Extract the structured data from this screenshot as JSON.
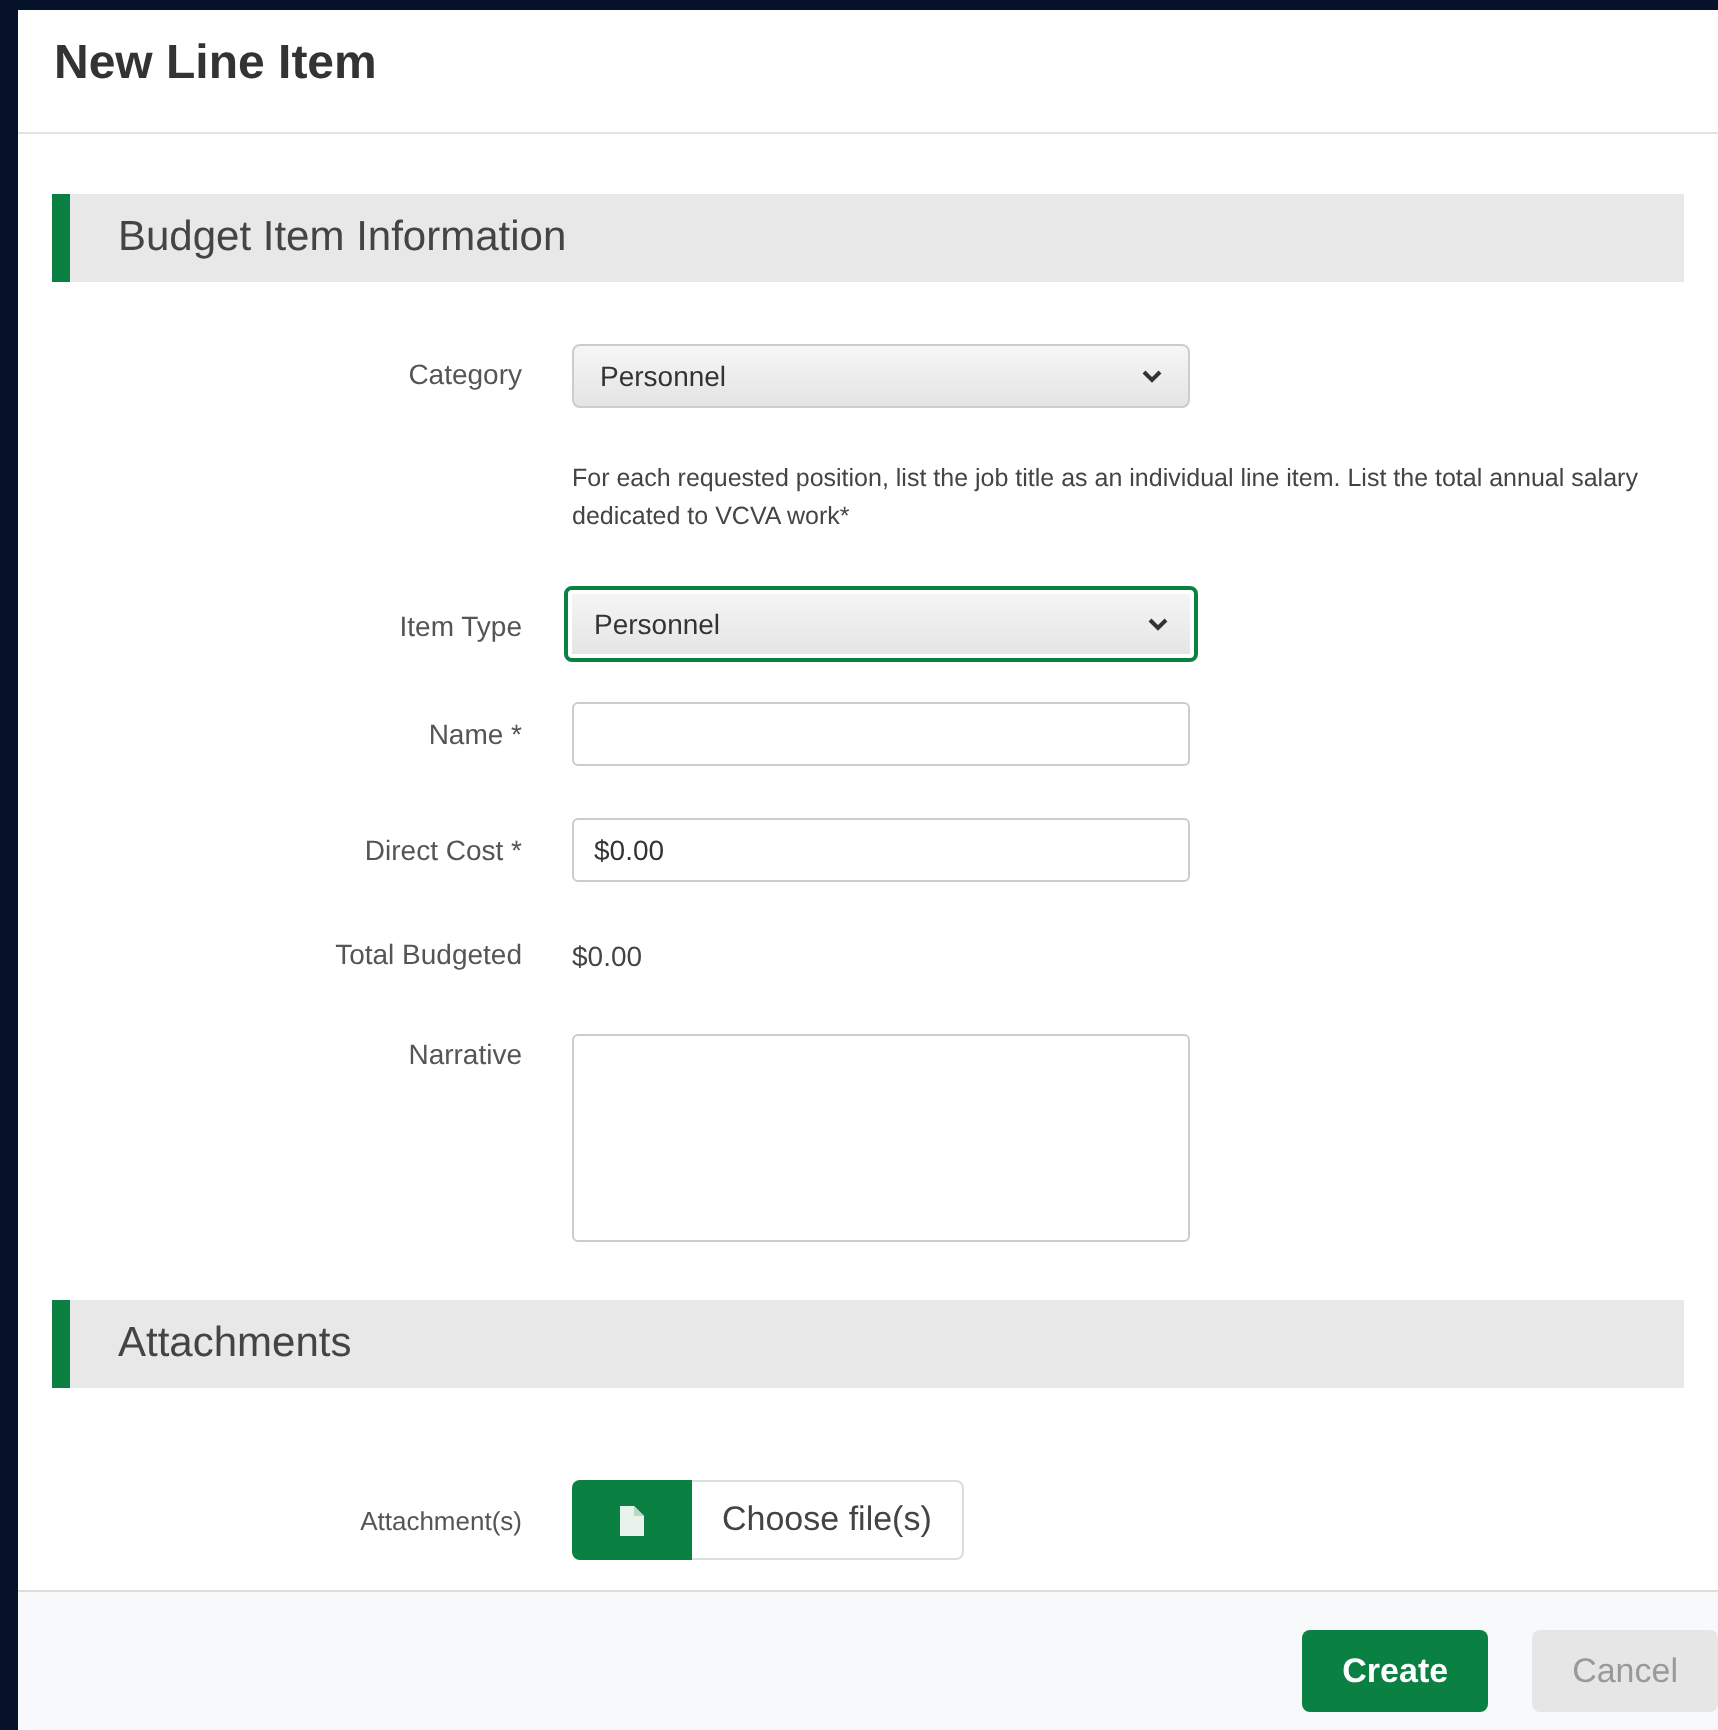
{
  "dialog": {
    "title": "New Line Item"
  },
  "sections": [
    {
      "title": "Budget Item Information",
      "fields": [
        {
          "kind": "select",
          "label": "Category",
          "value": "Personnel",
          "focused": false
        },
        {
          "kind": "help",
          "text": "For each requested position, list the job title as an individual line item. List the total annual salary dedicated to VCVA work*"
        },
        {
          "kind": "select",
          "label": "Item Type",
          "value": "Personnel",
          "focused": true
        },
        {
          "kind": "input",
          "label": "Name *"
        },
        {
          "kind": "input",
          "label": "Direct Cost *",
          "value": "$0.00"
        },
        {
          "kind": "static",
          "label": "Total Budgeted",
          "value": "$0.00"
        },
        {
          "kind": "textarea",
          "label": "Narrative"
        }
      ]
    },
    {
      "title": "Attachments",
      "fields": [
        {
          "kind": "file",
          "label": "Attachment(s)",
          "button": "Choose file(s)"
        }
      ]
    }
  ],
  "buttons": [
    {
      "label": "Create",
      "kind": "primary"
    },
    {
      "label": "Cancel",
      "kind": "secondary"
    }
  ]
}
